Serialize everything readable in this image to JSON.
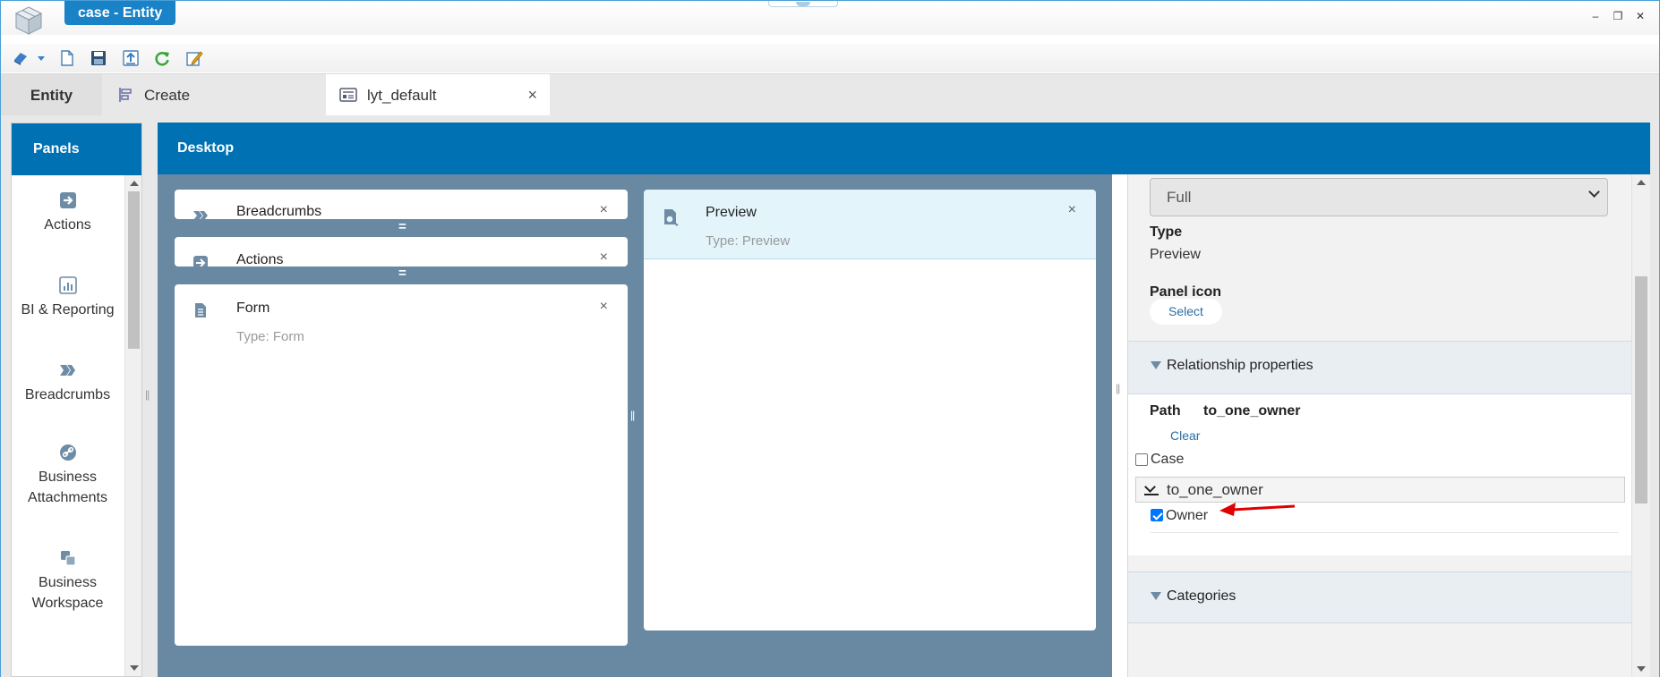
{
  "window": {
    "title": "case - Entity",
    "controls": {
      "minimize": "–",
      "restore": "❐",
      "close": "✕"
    }
  },
  "toolbar": {
    "icons": [
      "publish-icon",
      "dropdown-icon",
      "new-document-icon",
      "save-icon",
      "export-icon",
      "refresh-icon",
      "edit-icon"
    ]
  },
  "tabs": {
    "entity": "Entity",
    "create": "Create",
    "layout": "lyt_default",
    "close": "×"
  },
  "panels": {
    "header": "Panels",
    "items": [
      {
        "label": "Actions",
        "icon": "arrow-right-icon"
      },
      {
        "label": "BI & Reporting",
        "icon": "bar-chart-icon"
      },
      {
        "label": "Breadcrumbs",
        "icon": "breadcrumb-icon"
      },
      {
        "label": "Business Attachments",
        "line1": "Business",
        "line2": "Attachments",
        "icon": "link-icon"
      },
      {
        "label": "Business Workspace",
        "line1": "Business",
        "line2": "Workspace",
        "icon": "workspace-icon"
      }
    ]
  },
  "desktop": {
    "header": "Desktop",
    "cards": {
      "breadcrumbs": {
        "title": "Breadcrumbs"
      },
      "actions": {
        "title": "Actions"
      },
      "form": {
        "title": "Form",
        "type": "Type: Form"
      },
      "preview": {
        "title": "Preview",
        "type": "Type: Preview"
      }
    },
    "close": "×",
    "drag": "="
  },
  "properties": {
    "size_value": "Full",
    "type_label": "Type",
    "type_value": "Preview",
    "panel_icon_label": "Panel icon",
    "select_button": "Select",
    "relationship": {
      "title": "Relationship properties",
      "path_label": "Path",
      "path_value": "to_one_owner",
      "clear_button": "Clear",
      "case_label": "Case",
      "case_checked": false,
      "relation_node": "to_one_owner",
      "owner_label": "Owner",
      "owner_checked": true
    },
    "categories_title": "Categories"
  },
  "colors": {
    "header_blue": "#0071b3",
    "canvas": "#6989a3",
    "annotation_arrow": "#e00000"
  }
}
